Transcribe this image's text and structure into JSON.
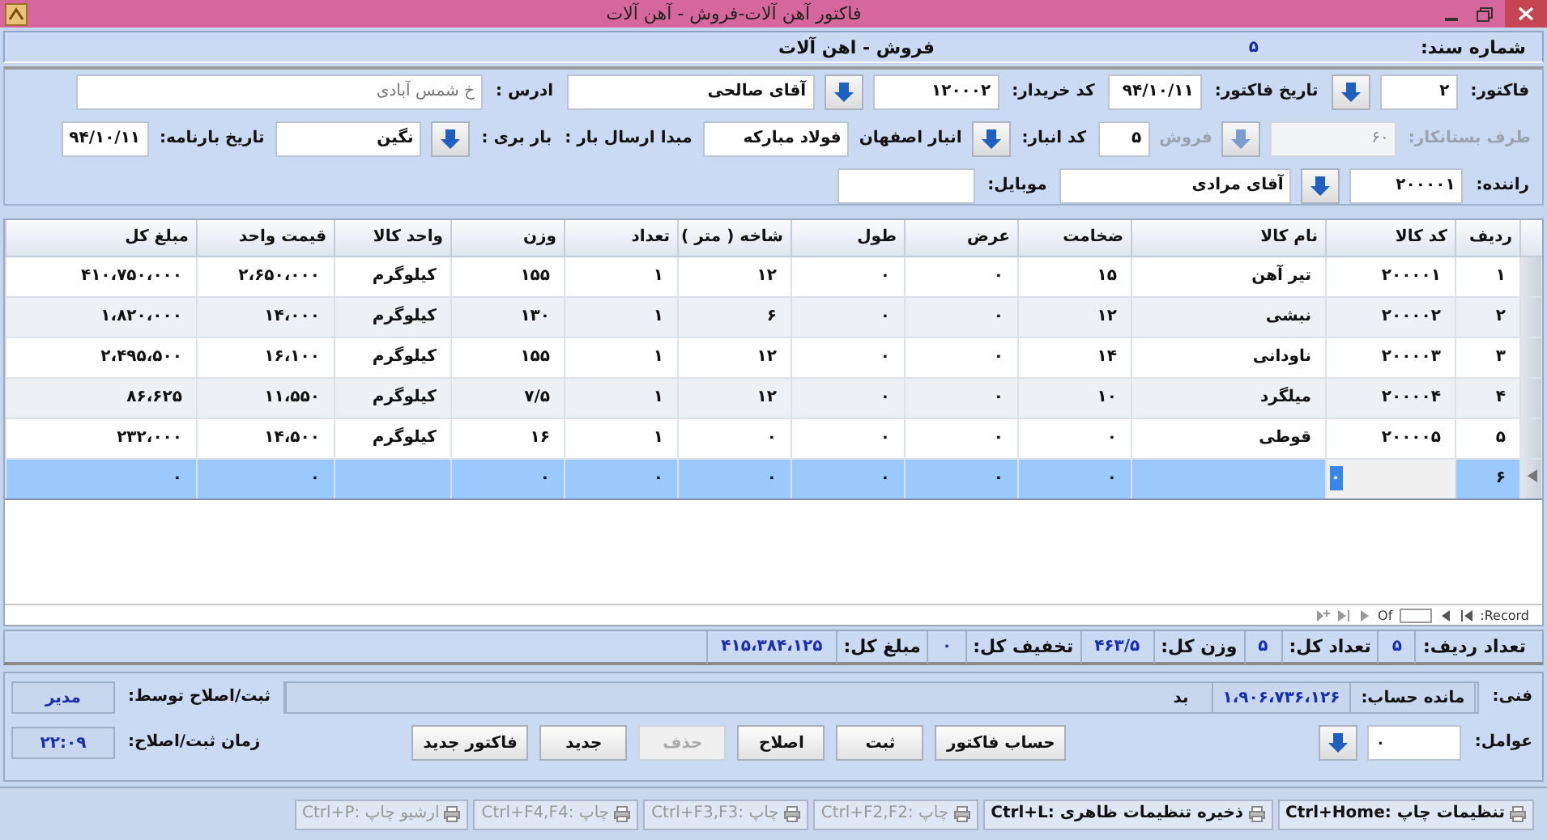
{
  "window": {
    "title": "فاکتور آهن آلات-فروش - آهن آلات"
  },
  "header": {
    "doc_number_label": "شماره سند:",
    "doc_number": "۵",
    "section_title": "فروش - اهن آلات"
  },
  "form": {
    "items": [
      {
        "kind": "label",
        "text": "فاکتور:",
        "disabled": false
      },
      {
        "kind": "field",
        "value": "۲",
        "disabled": false
      },
      {
        "kind": "lookup",
        "disabled": false
      },
      {
        "kind": "label",
        "text": "تاریخ فاکتور:",
        "disabled": false
      },
      {
        "kind": "field",
        "value": "۹۴/۱۰/۱۱",
        "disabled": false
      },
      {
        "kind": "label",
        "text": "کد خریدار:",
        "disabled": false
      },
      {
        "kind": "field",
        "value": "۱۲۰۰۰۲",
        "disabled": false
      },
      {
        "kind": "lookup",
        "disabled": false
      },
      {
        "kind": "field",
        "value": "آقای صالحی",
        "disabled": false
      },
      {
        "kind": "label",
        "text": "ادرس :",
        "disabled": false
      },
      {
        "kind": "field",
        "placeholder": "خ شمس آبادی",
        "disabled": false
      },
      {
        "kind": "label",
        "text": "طرف بستانکار:",
        "disabled": true
      },
      {
        "kind": "field",
        "value": "۶۰",
        "disabled": true
      },
      {
        "kind": "lookup",
        "disabled": true
      },
      {
        "kind": "text",
        "text": "فروش",
        "disabled": true
      },
      {
        "kind": "field",
        "value": "۵",
        "disabled": false
      },
      {
        "kind": "label",
        "text": "کد انبار:",
        "disabled": false
      },
      {
        "kind": "lookup",
        "disabled": false
      },
      {
        "kind": "text",
        "text": "انبار اصفهان",
        "disabled": false
      },
      {
        "kind": "field",
        "value": "فولاد مبارکه",
        "disabled": false
      },
      {
        "kind": "label",
        "text": "مبدا ارسال بار :",
        "disabled": false
      },
      {
        "kind": "label",
        "text": "بار بری :",
        "disabled": false
      },
      {
        "kind": "lookup",
        "disabled": false
      },
      {
        "kind": "field",
        "value": "نگین",
        "disabled": false
      },
      {
        "kind": "label",
        "text": "تاریخ بارنامه:",
        "disabled": false
      },
      {
        "kind": "field",
        "value": "۹۴/۱۰/۱۱",
        "disabled": false
      },
      {
        "kind": "label",
        "text": "راننده:",
        "disabled": false
      },
      {
        "kind": "field",
        "value": "۲۰۰۰۰۱",
        "disabled": false
      },
      {
        "kind": "lookup",
        "disabled": false
      },
      {
        "kind": "field",
        "value": "آقای مرادی",
        "disabled": false
      },
      {
        "kind": "label",
        "text": "موبایل:",
        "disabled": false
      },
      {
        "kind": "field",
        "disabled": false
      }
    ]
  },
  "table": {
    "columns": [
      "ردیف",
      "کد کالا",
      "نام کالا",
      "ضخامت",
      "عرض",
      "طول",
      "شاخه ( متر )",
      "تعداد",
      "وزن",
      "واحد کالا",
      "قیمت واحد",
      "مبلغ کل"
    ],
    "rows": [
      {
        "selected": false,
        "editing": false,
        "cells": [
          "۱",
          "۲۰۰۰۰۱",
          "تیر آهن",
          "۱۵",
          "۰",
          "۰",
          "۱۲",
          "۱",
          "۱۵۵",
          "کیلوگرم",
          "۲،۶۵۰،۰۰۰",
          "۴۱۰،۷۵۰،۰۰۰"
        ]
      },
      {
        "selected": false,
        "editing": false,
        "cells": [
          "۲",
          "۲۰۰۰۰۲",
          "نبشی",
          "۱۲",
          "۰",
          "۰",
          "۶",
          "۱",
          "۱۳۰",
          "کیلوگرم",
          "۱۴،۰۰۰",
          "۱،۸۲۰،۰۰۰"
        ]
      },
      {
        "selected": false,
        "editing": false,
        "cells": [
          "۳",
          "۲۰۰۰۰۳",
          "ناودانی",
          "۱۴",
          "۰",
          "۰",
          "۱۲",
          "۱",
          "۱۵۵",
          "کیلوگرم",
          "۱۶،۱۰۰",
          "۲،۴۹۵،۵۰۰"
        ]
      },
      {
        "selected": false,
        "editing": false,
        "cells": [
          "۴",
          "۲۰۰۰۰۴",
          "میلگرد",
          "۱۰",
          "۰",
          "۰",
          "۱۲",
          "۱",
          "۷/۵",
          "کیلوگرم",
          "۱۱،۵۵۰",
          "۸۶،۶۲۵"
        ]
      },
      {
        "selected": false,
        "editing": false,
        "cells": [
          "۵",
          "۲۰۰۰۰۵",
          "قوطی",
          "۰",
          "۰",
          "۰",
          "۰",
          "۱",
          "۱۶",
          "کیلوگرم",
          "۱۴،۵۰۰",
          "۲۳۲،۰۰۰"
        ]
      },
      {
        "selected": true,
        "editing": true,
        "cells": [
          "۶",
          "۰",
          null,
          "۰",
          "۰",
          "۰",
          "۰",
          "۰",
          "۰",
          null,
          "۰",
          "۰"
        ]
      }
    ],
    "navigator": {
      "record_label": "Record:",
      "of_label": "Of"
    }
  },
  "totals": [
    {
      "label": "تعداد ردیف:",
      "value": "۵"
    },
    {
      "label": "تعداد کل:",
      "value": "۵"
    },
    {
      "label": "وزن کل:",
      "value": "۴۶۳/۵"
    },
    {
      "label": "تخفیف کل:",
      "value": "۰"
    },
    {
      "label": "مبلغ کل:",
      "value": "۴۱۵،۳۸۴،۱۲۵"
    }
  ],
  "footer": {
    "tech_label": "فنی:",
    "balance_label": "مانده حساب:",
    "balance_value": "۱،۹۰۶،۷۳۶،۱۲۶",
    "balance_status": "بد",
    "editor_label": "ثبت/اصلاح توسط:",
    "editor_value": "مدیر",
    "agents_label": "عوامل:",
    "agents_value": "۰",
    "time_label": "زمان ثبت/اصلاح:",
    "time_value": "۲۲:۰۹",
    "buttons": [
      {
        "label": "حساب فاکتور",
        "disabled": false
      },
      {
        "label": "ثبت",
        "disabled": false
      },
      {
        "label": "اصلاح",
        "disabled": false
      },
      {
        "label": "حذف",
        "disabled": true
      },
      {
        "label": "جدید",
        "disabled": false
      },
      {
        "label": "فاکتور جدید",
        "disabled": false
      }
    ]
  },
  "status_bar": [
    {
      "text": "تنظیمات چاپ :Ctrl+Home",
      "disabled": false
    },
    {
      "text": "ذخیره تنظیمات ظاهری :Ctrl+L",
      "disabled": false
    },
    {
      "text": "چاپ :Ctrl+F2,F2",
      "disabled": true
    },
    {
      "text": "چاپ :Ctrl+F3,F3",
      "disabled": true
    },
    {
      "text": "چاپ :Ctrl+F4,F4",
      "disabled": true
    },
    {
      "text": "ارشیو چاپ :Ctrl+P",
      "disabled": true
    }
  ]
}
